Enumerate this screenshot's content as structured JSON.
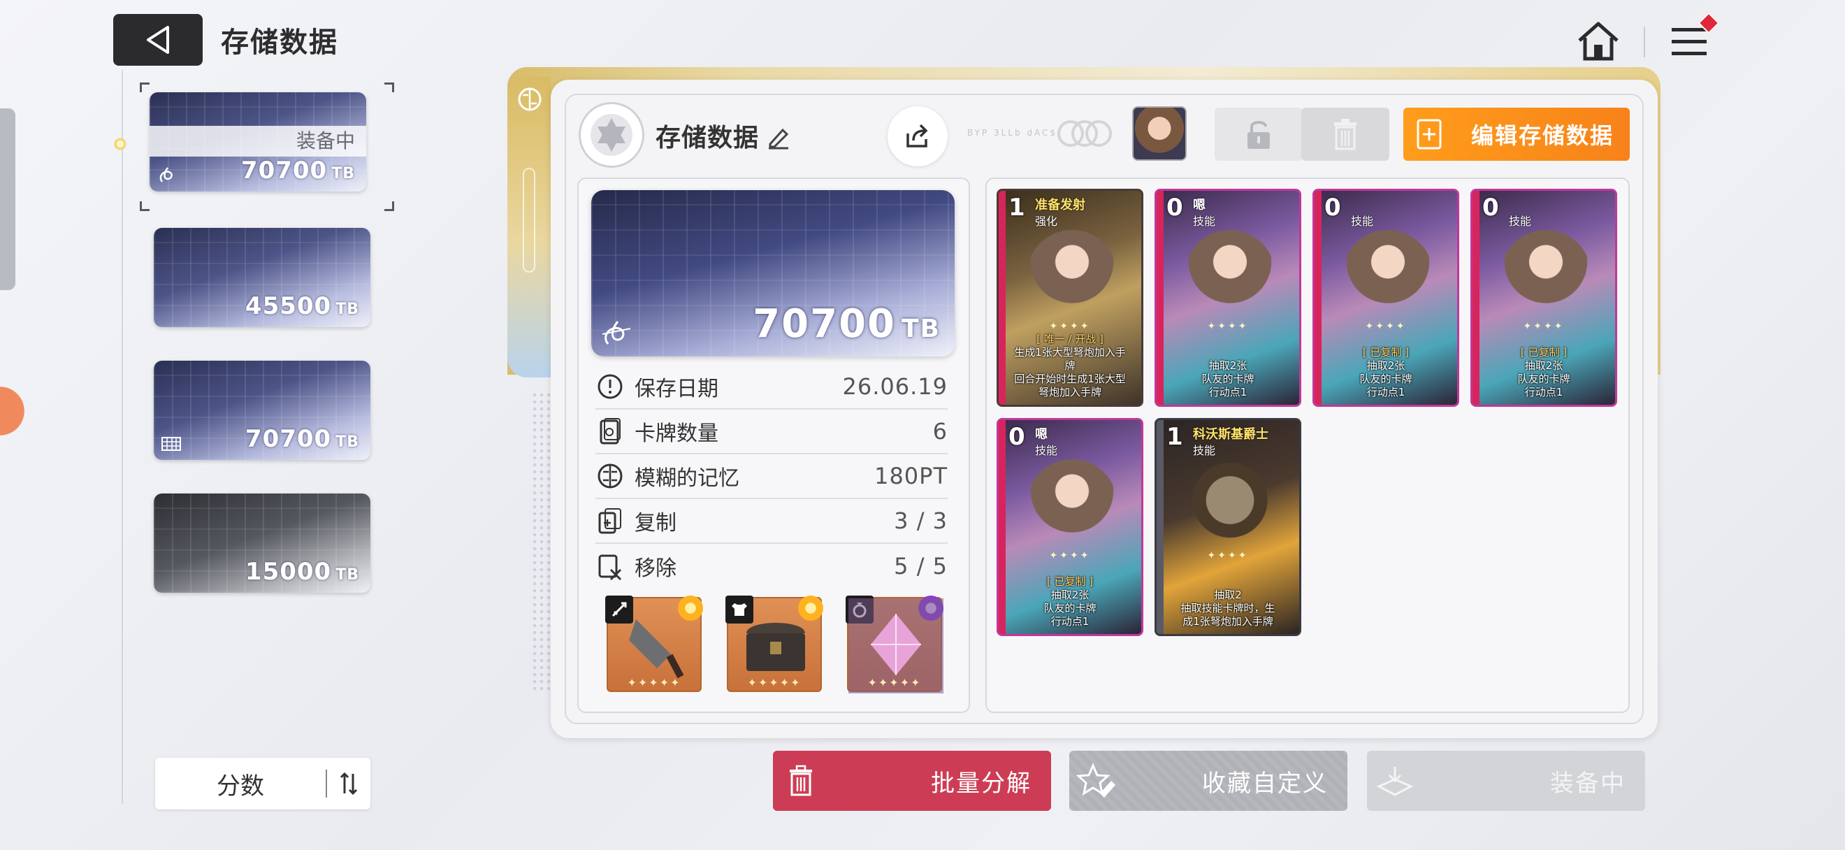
{
  "header": {
    "title": "存储数据"
  },
  "slots": [
    {
      "value": "70700",
      "unit": "TB",
      "status": "装备中",
      "selected": true,
      "tone": "purple"
    },
    {
      "value": "45500",
      "unit": "TB",
      "tone": "purple"
    },
    {
      "value": "70700",
      "unit": "TB",
      "tone": "purple"
    },
    {
      "value": "15000",
      "unit": "TB",
      "tone": "gray"
    }
  ],
  "sort": {
    "label": "分数"
  },
  "deck": {
    "name": "存储数据",
    "faint_text": "BYP 3LLb dAC$.",
    "edit_label": "编辑存储数据",
    "value": "70700",
    "unit": "TB"
  },
  "stats": [
    {
      "label": "保存日期",
      "value": "26.06.19",
      "icon": "clock-icon"
    },
    {
      "label": "卡牌数量",
      "value": "6",
      "icon": "card-count-icon"
    },
    {
      "label": "模糊的记忆",
      "value": "180PT",
      "icon": "brain-icon"
    },
    {
      "label": "复制",
      "value": "3 / 3",
      "icon": "copy-icon"
    },
    {
      "label": "移除",
      "value": "5 / 5",
      "icon": "remove-icon"
    }
  ],
  "equipment": [
    {
      "type": "weapon",
      "icon": "sword-icon",
      "item": "cleaver-icon",
      "stars": "✦✦✦✦✦",
      "gem_color": "#ffb21e"
    },
    {
      "type": "armor",
      "icon": "armor-icon",
      "item": "chest-icon",
      "stars": "✦✦✦✦✦",
      "gem_color": "#ffb21e"
    },
    {
      "type": "accessory",
      "icon": "ring-icon",
      "item": "crystal-icon",
      "stars": "✦✦✦✦✦",
      "gem_color": "#8a3ad8"
    }
  ],
  "cards": [
    {
      "cost": "1",
      "name": "准备发射",
      "type": "强化",
      "style": "gold",
      "stars": "✦✦✦✦",
      "desc": [
        "[ 唯一 / 开战 ]",
        "生成1张大型弩炮加入手",
        "牌",
        "回合开始时生成1张大型",
        "弩炮加入手牌"
      ]
    },
    {
      "cost": "0",
      "name": "嗯",
      "type": "技能",
      "style": "skill",
      "stars": "✦✦✦✦",
      "desc": [
        "抽取2张",
        "队友的卡牌",
        "行动点1"
      ]
    },
    {
      "cost": "0",
      "name": "",
      "type": "技能",
      "style": "skill",
      "stars": "✦✦✦✦",
      "desc": [
        "[ 已复制 ]",
        "抽取2张",
        "队友的卡牌",
        "行动点1"
      ]
    },
    {
      "cost": "0",
      "name": "",
      "type": "技能",
      "style": "skill",
      "stars": "✦✦✦✦",
      "desc": [
        "[ 已复制 ]",
        "抽取2张",
        "队友的卡牌",
        "行动点1"
      ]
    },
    {
      "cost": "0",
      "name": "嗯",
      "type": "技能",
      "style": "skill",
      "stars": "✦✦✦✦",
      "desc": [
        "[ 已复制 ]",
        "抽取2张",
        "队友的卡牌",
        "行动点1"
      ]
    },
    {
      "cost": "1",
      "name": "科沃斯基爵士",
      "type": "技能",
      "style": "dark",
      "stars": "✦✦✦✦",
      "desc": [
        "抽取2",
        "抽取技能卡牌时，生",
        "成1张弩炮加入手牌"
      ]
    }
  ],
  "actions": {
    "disassemble": "批量分解",
    "favorite": "收藏自定义",
    "equipped": "装备中"
  },
  "colors": {
    "accent_orange": "#f7821a",
    "danger_red": "#cc3d55",
    "dark": "#2b2b2e"
  }
}
